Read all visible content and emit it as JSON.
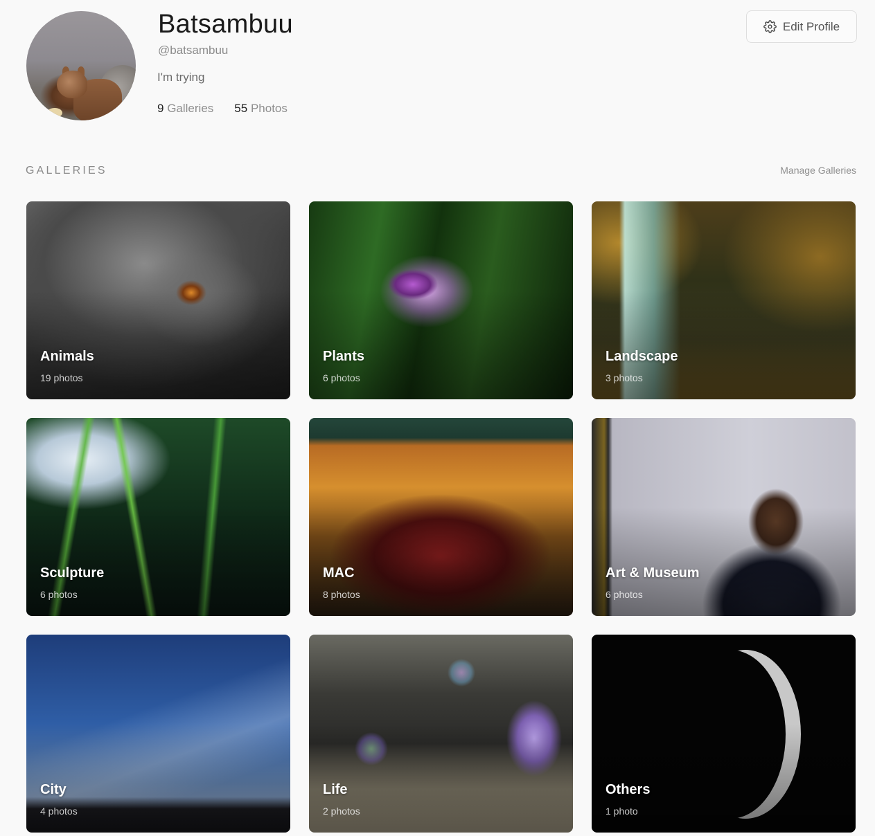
{
  "profile": {
    "name": "Batsambuu",
    "handle": "@batsambuu",
    "bio": "I'm trying",
    "galleries_count": "9",
    "galleries_label": "Galleries",
    "photos_count": "55",
    "photos_label": "Photos",
    "edit_button_label": "Edit Profile",
    "edit_button_icon": "gear-icon"
  },
  "galleries_section": {
    "title": "GALLERIES",
    "manage_link": "Manage Galleries"
  },
  "galleries": [
    {
      "title": "Animals",
      "count": "19 photos"
    },
    {
      "title": "Plants",
      "count": "6 photos"
    },
    {
      "title": "Landscape",
      "count": "3 photos"
    },
    {
      "title": "Sculpture",
      "count": "6 photos"
    },
    {
      "title": "MAC",
      "count": "8 photos"
    },
    {
      "title": "Art & Museum",
      "count": "6 photos"
    },
    {
      "title": "City",
      "count": "4 photos"
    },
    {
      "title": "Life",
      "count": "2 photos"
    },
    {
      "title": "Others",
      "count": "1 photo"
    }
  ]
}
